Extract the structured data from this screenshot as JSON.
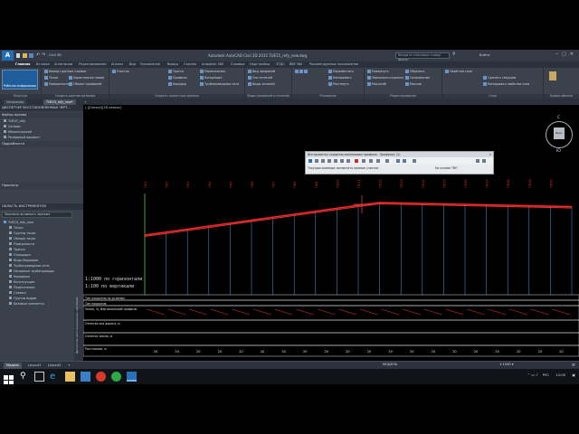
{
  "app": {
    "logo": "A",
    "window_title": "Autodesk AutoCAD Civil 3D 2015   TUE15_mfy_new.dwg",
    "workspace": "Civil 3D",
    "search_placeholder": "Введите ключевое слово/фразу",
    "user": "Войти"
  },
  "ribbon_tabs": [
    "Главная",
    "Вставка",
    "Аннотации",
    "Редактирование",
    "Анализ",
    "Вид",
    "Управление",
    "Вывод",
    "Съемка",
    "Autodesk 360",
    "Справка",
    "Надстройки",
    "ЭТДС",
    "BIM 360",
    "Рекомендуемые приложения"
  ],
  "ribbon": {
    "big_button": "Рабочая информация",
    "panels": [
      {
        "title": "Палитры",
        "cmds": []
      },
      {
        "title": "Создать данные рельефа",
        "cmds": [
          "Импорт данных съемки",
          "Точки",
          "Поверхности",
          "Характерная линия",
          "Объект профилей",
          "Объект профиля трассы"
        ]
      },
      {
        "title": "Создать проектные данные",
        "cmds": [
          "Участок",
          "Трасса",
          "Профиль",
          "Коридор",
          "Пересечения",
          "Концепция",
          "Трубопроводные сети"
        ]
      },
      {
        "title": "Виды профилей и сечений",
        "cmds": [
          "Вид профилей",
          "Оси сечений",
          "Виды сечений"
        ]
      },
      {
        "title": "Рисование",
        "cmds": [
          "Переместить",
          "Копировать",
          "Растянуть",
          "Повернуть",
          "Обрезать",
          "Масштаб",
          "Зеркально отразить",
          "Массив",
          "Сопряжение"
        ]
      },
      {
        "title": "Редактирование",
        "cmds": [
          "Удалить",
          "Расчленить",
          "Сместить"
        ]
      },
      {
        "title": "Слои",
        "cmds": [
          "Свойства слоя",
          "Сделать текущим",
          "Копировать свойства слоя"
        ]
      },
      {
        "title": "Буфер обмена",
        "cmds": [
          "Вставить"
        ]
      }
    ]
  },
  "doc_tabs": [
    "Начальная",
    "TUE15_mfy_new*"
  ],
  "left_panel": {
    "title": "ДИСПЕТЧЕР ВОССТАНОВЛЕННЫХ ЧЕРТ...",
    "files_header": "Файлы архива",
    "files": [
      "TUE47_mfy",
      "Основы",
      "Механический",
      "Резервный вариант"
    ],
    "details_header": "Подробности",
    "preview_header": "Просмотр",
    "toolspace_header": "ОБЛАСТЬ ИНСТРУМЕНТОВ",
    "toolspace_filter": "Просмотр активного чертежа",
    "tree_root": "TUE15_mfy_new",
    "tree": [
      "Точки",
      "Группы точек",
      "Облака точек",
      "Поверхности",
      "Трассы",
      "Площадки",
      "Виды барьеров",
      "Трубопроводные сети",
      "Напорные трубопроводы",
      "Коридоры",
      "Конструкции",
      "Пересечения",
      "Съемка",
      "Группы видов",
      "Базовые элементы"
    ],
    "side_label": "Диспетчер восстановленных чертежей"
  },
  "viewport": {
    "label": "[-][Сверху][2D-каркас]",
    "viewcube_top": "Верх",
    "dir_n": "С",
    "dir_s": "Ю",
    "dir_w": "З",
    "dir_e": "В",
    "scale_text_1": "1:1000 по горизонтали",
    "scale_text_2": "1:100 по вертикали"
  },
  "cmd_popup": {
    "title": "Инструменты создания компоновки профиля - Профиль1 (1)",
    "prompt": "Текущая команда: вычертить прямые участки",
    "osnap": "На основе ТВП"
  },
  "profile_view": {
    "station_labels": [
      "ПК1",
      "ПК2",
      "ПК3",
      "ПК4",
      "ПК5",
      "ПК6",
      "ПК7",
      "ПК8",
      "ПК9",
      "ПК10",
      "ПК11",
      "ПК12",
      "ПК13",
      "ПК14",
      "ПК15",
      "ПК16",
      "ПК17",
      "ПК18",
      "ПК19",
      "ПК20"
    ],
    "row_labels": [
      "Тип покрытия по уклонам",
      "Тип покрытия",
      "Уклон, %, Вертикальный профиль",
      "Отметка оси дороги, м",
      "Отметка земли, м",
      "Расстояние, м"
    ],
    "distance_values": [
      "20",
      "20",
      "20",
      "20",
      "20",
      "20",
      "20",
      "20",
      "20",
      "20",
      "20",
      "20",
      "20",
      "20",
      "20",
      "20",
      "20",
      "20",
      "20",
      "20"
    ],
    "colors": {
      "ground": "#ff2b2b",
      "design": "#e8383a",
      "grid": "#4a9fd6",
      "axis": "#2fa84a"
    }
  },
  "layout_tabs": [
    "Модель",
    "Layout1",
    "Layout2"
  ],
  "status": {
    "model": "МОДЕЛЬ",
    "scale": "1:1000 ▾"
  },
  "taskbar": {
    "lang": "РУС",
    "time": "14:00"
  }
}
